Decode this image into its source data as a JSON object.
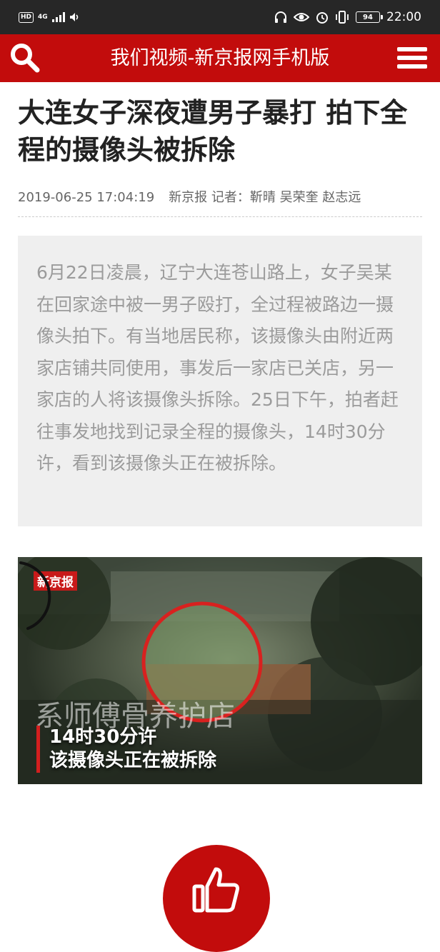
{
  "status_bar": {
    "hd": "HD",
    "network": "4G",
    "battery": "94",
    "time": "22:00"
  },
  "header": {
    "title": "我们视频-新京报网手机版",
    "search_icon": "search-icon",
    "menu_icon": "hamburger-menu-icon"
  },
  "article": {
    "title": "大连女子深夜遭男子暴打 拍下全程的摄像头被拆除",
    "datetime": "2019-06-25 17:04:19",
    "source": "新京报 记者：靳晴 吴荣奎 赵志远",
    "summary": "6月22日凌晨，辽宁大连苍山路上，女子吴某在回家途中被一男子殴打，全过程被路边一摄像头拍下。有当地居民称，该摄像头由附近两家店铺共同使用，事发后一家店已关店，另一家店的人将该摄像头拆除。25日下午，拍者赶往事发地找到记录全程的摄像头，14时30分许，看到该摄像头正在被拆除。"
  },
  "video": {
    "logo": "新京报",
    "sign_text": "系师傅骨养护店",
    "caption_line1": "14时30分许",
    "caption_line2": "该摄像头正在被拆除"
  },
  "like": {
    "icon": "thumbs-up-icon"
  },
  "colors": {
    "brand_red": "#c20c0c",
    "status_bar": "#272727",
    "summary_bg": "#efefef"
  }
}
